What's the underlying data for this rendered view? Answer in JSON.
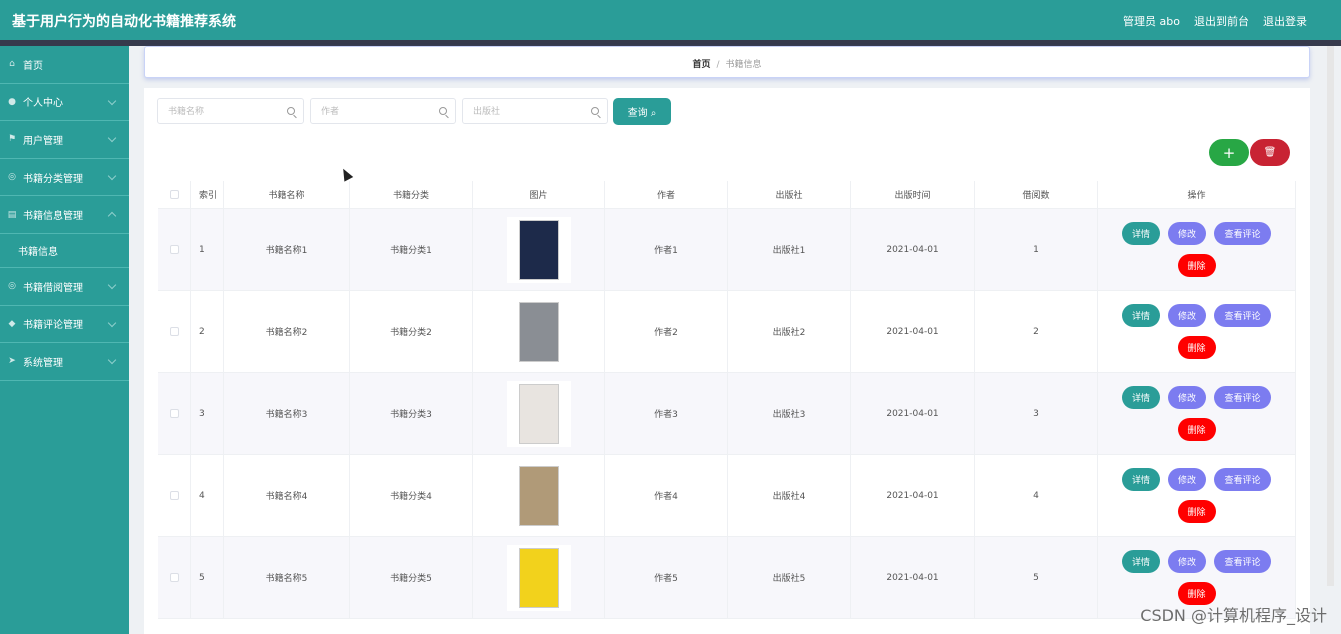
{
  "app_title": "基于用户行为的自动化书籍推荐系统",
  "header": {
    "admin": "管理员 abo",
    "front": "退出到前台",
    "logout": "退出登录"
  },
  "sidebar": {
    "items": [
      {
        "label": "首页",
        "icon": "home-icon"
      },
      {
        "label": "个人中心",
        "icon": "user-icon"
      },
      {
        "label": "用户管理",
        "icon": "flag-icon"
      },
      {
        "label": "书籍分类管理",
        "icon": "circle-icon"
      },
      {
        "label": "书籍信息管理",
        "icon": "book-icon"
      },
      {
        "label": "书籍信息",
        "icon": ""
      },
      {
        "label": "书籍借阅管理",
        "icon": "circle-icon"
      },
      {
        "label": "书籍评论管理",
        "icon": "pin-icon"
      },
      {
        "label": "系统管理",
        "icon": "send-icon"
      }
    ]
  },
  "breadcrumb": {
    "home": "首页",
    "sep": "/",
    "current": "书籍信息"
  },
  "search": {
    "name_placeholder": "书籍名称",
    "author_placeholder": "作者",
    "publisher_placeholder": "出版社",
    "query_label": "查询 ⌕"
  },
  "toolbar": {
    "add_label": "+",
    "delete_icon": "trash-icon"
  },
  "table": {
    "headers": [
      "索引",
      "书籍名称",
      "书籍分类",
      "图片",
      "作者",
      "出版社",
      "出版时间",
      "借阅数",
      "操作"
    ],
    "rows": [
      {
        "index": "1",
        "name": "书籍名称1",
        "category": "书籍分类1",
        "author": "作者1",
        "publisher": "出版社1",
        "date": "2021-04-01",
        "borrow": "1",
        "cover": "#1d2a4a"
      },
      {
        "index": "2",
        "name": "书籍名称2",
        "category": "书籍分类2",
        "author": "作者2",
        "publisher": "出版社2",
        "date": "2021-04-01",
        "borrow": "2",
        "cover": "#8a8e94"
      },
      {
        "index": "3",
        "name": "书籍名称3",
        "category": "书籍分类3",
        "author": "作者3",
        "publisher": "出版社3",
        "date": "2021-04-01",
        "borrow": "3",
        "cover": "#e8e4e0"
      },
      {
        "index": "4",
        "name": "书籍名称4",
        "category": "书籍分类4",
        "author": "作者4",
        "publisher": "出版社4",
        "date": "2021-04-01",
        "borrow": "4",
        "cover": "#b09a78"
      },
      {
        "index": "5",
        "name": "书籍名称5",
        "category": "书籍分类5",
        "author": "作者5",
        "publisher": "出版社5",
        "date": "2021-04-01",
        "borrow": "5",
        "cover": "#f2d21c"
      }
    ],
    "actions": {
      "detail": "详情",
      "edit": "修改",
      "review": "查看评论",
      "remove": "删除"
    }
  },
  "watermark": "CSDN @计算机程序_设计"
}
